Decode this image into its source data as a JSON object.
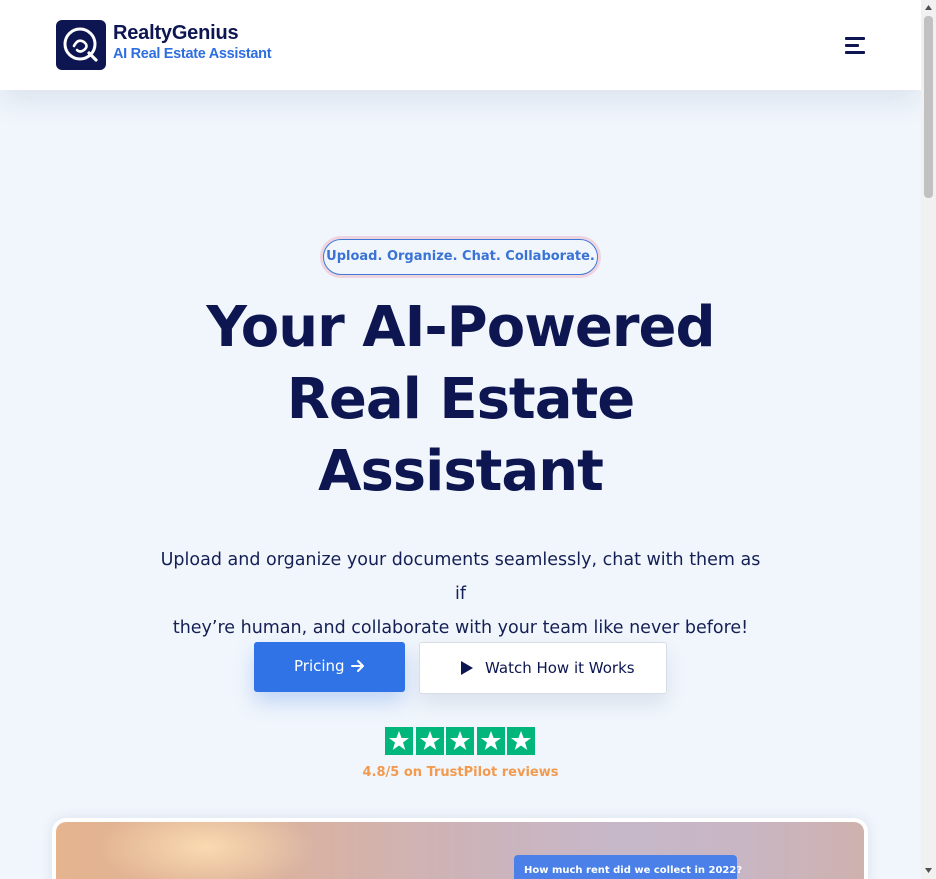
{
  "header": {
    "brand_name": "RealtyGenius",
    "brand_tagline": "AI Real Estate Assistant",
    "menu_icon": "hamburger-menu-icon"
  },
  "hero": {
    "pill_text": "Upload. Organize. Chat. Collaborate.",
    "headline_line1": "Your AI-Powered",
    "headline_line2": "Real Estate",
    "headline_line3": "Assistant",
    "subtext_line1": "Upload and organize your documents seamlessly, chat with them as if",
    "subtext_line2": "they’re human, and collaborate with your team like never before!",
    "pricing_label": "Pricing",
    "watch_label": "Watch How it Works",
    "rating_text": "4.8/5 on TrustPilot reviews",
    "star_count": 5
  },
  "preview": {
    "chat_question": "How much rent did we collect in 2022?"
  },
  "colors": {
    "navy": "#0d1650",
    "accent_blue": "#2f73e6",
    "trustpilot_green": "#00b67a",
    "rating_orange": "#f29a4e",
    "background": "#f1f6fc"
  }
}
